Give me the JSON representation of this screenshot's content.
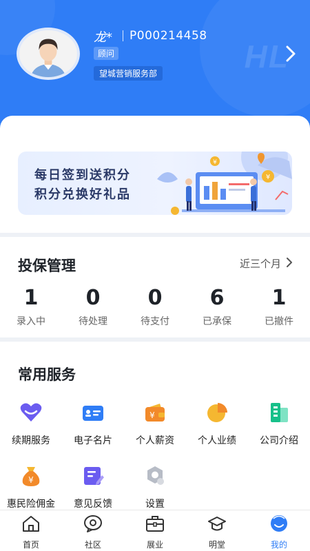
{
  "profile": {
    "name": "龙*",
    "id": "P000214458",
    "role": "顾问",
    "department": "望城营销服务部"
  },
  "banner": {
    "line1": "每日签到送积分",
    "line2": "积分兑换好礼品"
  },
  "policy": {
    "title": "投保管理",
    "period": "近三个月",
    "stats": [
      {
        "value": "1",
        "label": "录入中"
      },
      {
        "value": "0",
        "label": "待处理"
      },
      {
        "value": "0",
        "label": "待支付"
      },
      {
        "value": "6",
        "label": "已承保"
      },
      {
        "value": "1",
        "label": "已撤件"
      }
    ]
  },
  "services": {
    "title": "常用服务",
    "items": [
      {
        "label": "续期服务",
        "icon": "heart-icon"
      },
      {
        "label": "电子名片",
        "icon": "business-card-icon"
      },
      {
        "label": "个人薪资",
        "icon": "wallet-icon"
      },
      {
        "label": "个人业绩",
        "icon": "pie-chart-icon"
      },
      {
        "label": "公司介绍",
        "icon": "building-icon"
      },
      {
        "label": "惠民险佣金",
        "icon": "money-bag-icon"
      },
      {
        "label": "意见反馈",
        "icon": "feedback-icon"
      },
      {
        "label": "设置",
        "icon": "settings-icon"
      }
    ]
  },
  "nav": {
    "items": [
      {
        "label": "首页",
        "icon": "home-icon"
      },
      {
        "label": "社区",
        "icon": "community-icon"
      },
      {
        "label": "展业",
        "icon": "briefcase-icon"
      },
      {
        "label": "明堂",
        "icon": "graduation-cap-icon"
      },
      {
        "label": "我的",
        "icon": "profile-icon"
      }
    ],
    "active": "我的"
  },
  "colors": {
    "primary": "#2f7df6",
    "text": "#1f2329",
    "background": "#eef1f6"
  }
}
